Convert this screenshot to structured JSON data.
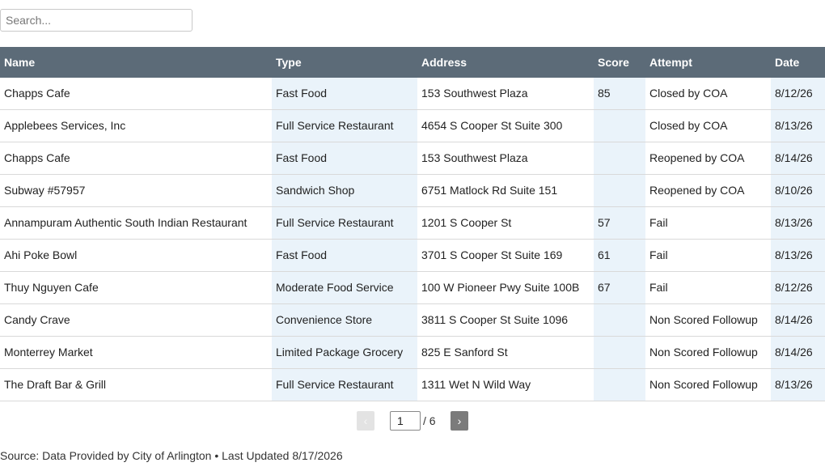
{
  "search": {
    "placeholder": "Search..."
  },
  "table": {
    "columns": [
      "Name",
      "Type",
      "Address",
      "Score",
      "Attempt",
      "Date"
    ],
    "rows": [
      [
        "Chapps Cafe",
        "Fast Food",
        "153 Southwest Plaza",
        "85",
        "Closed by COA",
        "8/12/26"
      ],
      [
        "Applebees Services, Inc",
        "Full Service Restaurant",
        "4654 S Cooper St Suite 300",
        "",
        "Closed by COA",
        "8/13/26"
      ],
      [
        "Chapps Cafe",
        "Fast Food",
        "153 Southwest Plaza",
        "",
        "Reopened by COA",
        "8/14/26"
      ],
      [
        "Subway #57957",
        "Sandwich Shop",
        "6751 Matlock Rd Suite 151",
        "",
        "Reopened by COA",
        "8/10/26"
      ],
      [
        "Annampuram Authentic South Indian Restaurant",
        "Full Service Restaurant",
        "1201 S Cooper St",
        "57",
        "Fail",
        "8/13/26"
      ],
      [
        "Ahi Poke Bowl",
        "Fast Food",
        "3701 S Cooper St Suite 169",
        "61",
        "Fail",
        "8/13/26"
      ],
      [
        "Thuy Nguyen Cafe",
        "Moderate Food Service",
        "100 W Pioneer Pwy Suite 100B",
        "67",
        "Fail",
        "8/12/26"
      ],
      [
        "Candy Crave",
        "Convenience Store",
        "3811 S Cooper St Suite 1096",
        "",
        "Non Scored Followup",
        "8/14/26"
      ],
      [
        "Monterrey Market",
        "Limited Package Grocery",
        "825 E Sanford St",
        "",
        "Non Scored Followup",
        "8/14/26"
      ],
      [
        "The Draft Bar & Grill",
        "Full Service Restaurant",
        "1311 Wet N Wild Way",
        "",
        "Non Scored Followup",
        "8/13/26"
      ]
    ]
  },
  "pagination": {
    "prev_label": "‹",
    "next_label": "›",
    "current_page": "1",
    "total_label": "/ 6"
  },
  "footer": {
    "text": "Source: Data Provided by City of Arlington • Last Updated 8/17/2026"
  },
  "colors": {
    "header_bg": "#5c6b78",
    "shaded_column": "#eaf3fa"
  }
}
